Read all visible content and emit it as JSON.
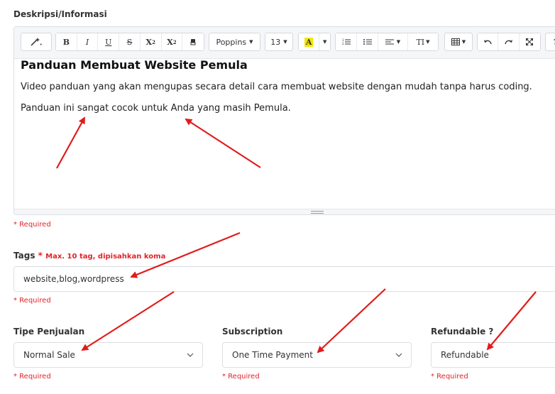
{
  "description": {
    "label": "Deskripsi/Informasi",
    "required": "* Required",
    "toolbar": {
      "magic": "magic-wand",
      "bold": "B",
      "italic": "I",
      "underline": "U",
      "strike": "S",
      "superscript": "X",
      "subscript": "X",
      "eraser": "eraser",
      "font_family": "Poppins",
      "font_size": "13",
      "color_letter": "A",
      "highlight_color": "#f3e600",
      "paragraph_style": "TI"
    },
    "content": {
      "heading": "Panduan Membuat Website Pemula",
      "paragraph1": "Video panduan yang akan mengupas secara detail cara membuat website dengan mudah tanpa harus coding.",
      "paragraph2": "Panduan ini sangat cocok untuk Anda yang masih Pemula."
    }
  },
  "tags": {
    "label": "Tags",
    "star": "*",
    "hint": "Max. 10 tag, dipisahkan koma",
    "value": "website,blog,wordpress",
    "required": "* Required"
  },
  "sale_type": {
    "label": "Tipe Penjualan",
    "value": "Normal Sale",
    "required": "* Required"
  },
  "subscription": {
    "label": "Subscription",
    "value": "One Time Payment",
    "required": "* Required"
  },
  "refundable": {
    "label": "Refundable ?",
    "value": "Refundable",
    "required": "* Required"
  },
  "colors": {
    "required_red": "#e0242a",
    "arrow_red": "#e21b1b"
  }
}
